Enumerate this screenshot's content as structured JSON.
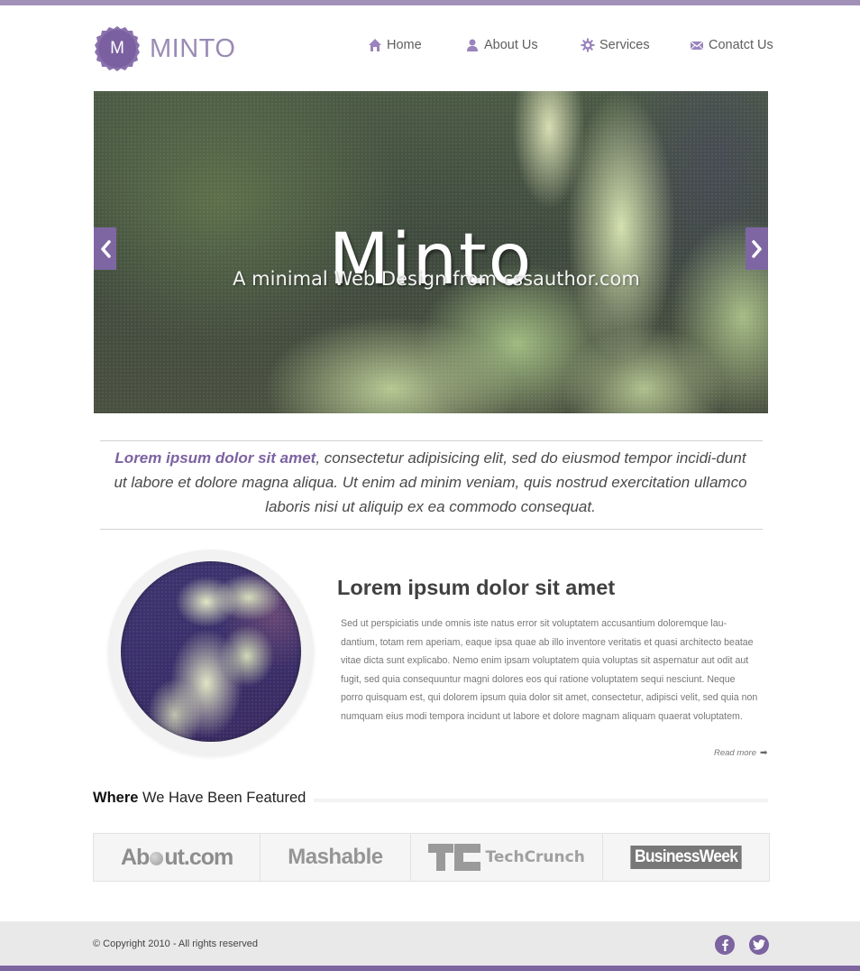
{
  "brand": {
    "logo_letter": "M",
    "name": "MINTO",
    "accent_color": "#7c62a1",
    "light_accent_color": "#a191b8"
  },
  "nav": {
    "items": [
      {
        "label": "Home",
        "icon": "home-icon"
      },
      {
        "label": "About Us",
        "icon": "user-icon"
      },
      {
        "label": "Services",
        "icon": "gear-icon"
      },
      {
        "label": "Conatct Us",
        "icon": "envelope-icon"
      }
    ]
  },
  "hero": {
    "title": "Minto",
    "subtitle": "A minimal Web Design  from cssauthor.com",
    "prev_icon": "chevron-left-icon",
    "next_icon": "chevron-right-icon"
  },
  "intro": {
    "highlight": "Lorem ipsum dolor sit amet",
    "text": ", consectetur adipisicing elit, sed do eiusmod tempor incidi-dunt ut labore et dolore magna aliqua. Ut enim ad minim veniam, quis nostrud exercitation ullamco laboris nisi ut aliquip ex ea commodo consequat."
  },
  "feature": {
    "title": "Lorem ipsum dolor sit amet",
    "body": "Sed ut perspiciatis unde omnis iste natus error sit voluptatem accusantium doloremque lau-dantium, totam rem aperiam, eaque ipsa quae ab illo inventore veritatis et quasi architecto beatae vitae dicta sunt explicabo. Nemo enim ipsam voluptatem quia voluptas sit aspernatur aut odit aut fugit, sed quia consequuntur magni dolores eos qui ratione voluptatem sequi nesciunt. Neque porro quisquam est, qui dolorem ipsum quia dolor sit amet, consectetur, adipisci velit, sed quia non numquam eius modi tempora incidunt ut labore et dolore magnam aliquam quaerat voluptatem.",
    "read_more": "Read more",
    "read_more_arrow": "➡"
  },
  "featured": {
    "heading_bold": "Where",
    "heading_rest": " We Have Been Featured",
    "logos": [
      {
        "name": "About.com",
        "part1": "Ab",
        "part2": "ut.com"
      },
      {
        "name": "Mashable"
      },
      {
        "name": "TechCrunch"
      },
      {
        "name": "BusinessWeek"
      }
    ]
  },
  "footer": {
    "copyright": "© Copyright 2010 - All rights reserved",
    "social": [
      {
        "name": "facebook",
        "glyph": "f"
      },
      {
        "name": "twitter",
        "glyph": "t"
      }
    ]
  }
}
